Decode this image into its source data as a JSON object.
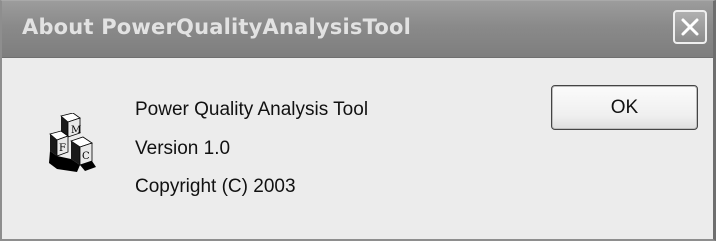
{
  "window": {
    "title": "About PowerQualityAnalysisTool",
    "close_icon": "close-icon"
  },
  "app": {
    "icon": "mfc-cube-logo",
    "name": "Power Quality Analysis Tool",
    "version": "Version 1.0",
    "copyright": "Copyright (C) 2003"
  },
  "buttons": {
    "ok_label": "OK"
  }
}
